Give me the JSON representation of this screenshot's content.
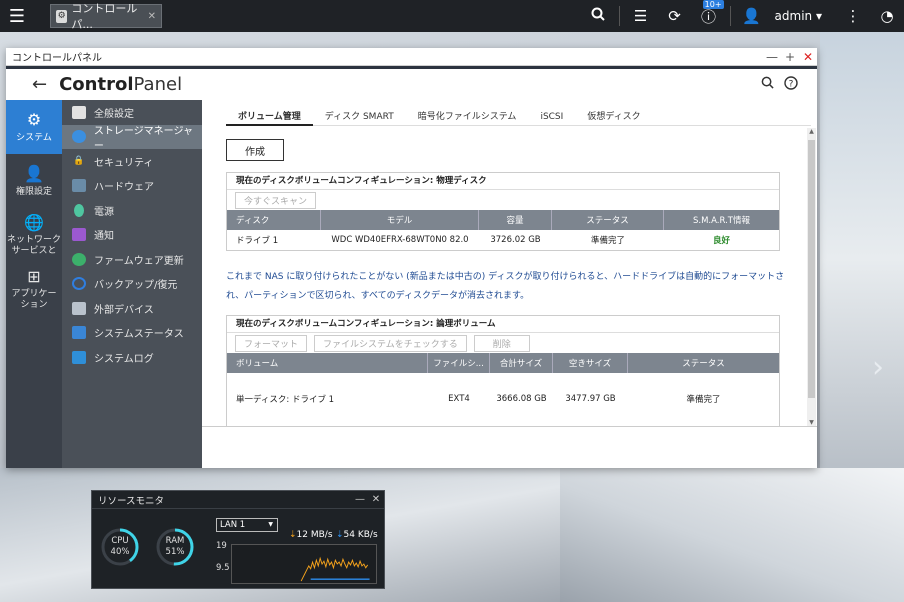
{
  "taskbar": {
    "tab_label": "コントロールパ...",
    "notifications_badge": "10+",
    "user": "admin"
  },
  "window": {
    "title": "コントロールパネル",
    "app_title_bold": "Control",
    "app_title_light": "Panel"
  },
  "rail": [
    {
      "label": "システム",
      "icon": "gear-icon"
    },
    {
      "label": "権限設定",
      "icon": "user-icon"
    },
    {
      "label": "ネットワーク\nサービスと",
      "icon": "globe-icon"
    },
    {
      "label": "アプリケー\nション",
      "icon": "apps-icon"
    }
  ],
  "subnav": [
    {
      "label": "全般設定",
      "icon": "general-settings-icon",
      "color": "#e2e2e2"
    },
    {
      "label": "ストレージマネージャー",
      "icon": "storage-icon",
      "color": "#3b8fe0"
    },
    {
      "label": "セキュリティ",
      "icon": "lock-icon",
      "color": "#d8d8d8"
    },
    {
      "label": "ハードウェア",
      "icon": "hardware-icon",
      "color": "#6a8ca8"
    },
    {
      "label": "電源",
      "icon": "power-icon",
      "color": "#4fc6a0"
    },
    {
      "label": "通知",
      "icon": "notification-icon",
      "color": "#9b59d0"
    },
    {
      "label": "ファームウェア更新",
      "icon": "firmware-icon",
      "color": "#3cb06b"
    },
    {
      "label": "バックアップ/復元",
      "icon": "backup-icon",
      "color": "#2f7ee0"
    },
    {
      "label": "外部デバイス",
      "icon": "external-device-icon",
      "color": "#b9c2cc"
    },
    {
      "label": "システムステータス",
      "icon": "system-status-icon",
      "color": "#3a86d6"
    },
    {
      "label": "システムログ",
      "icon": "system-log-icon",
      "color": "#2f8fd8"
    }
  ],
  "tabs": [
    "ボリューム管理",
    "ディスク SMART",
    "暗号化ファイルシステム",
    "iSCSI",
    "仮想ディスク"
  ],
  "create_button": "作成",
  "physical": {
    "title": "現在のディスクボリュームコンフィギュレーション: 物理ディスク",
    "scan_button": "今すぐスキャン",
    "headers": [
      "ディスク",
      "モデル",
      "容量",
      "ステータス",
      "S.M.A.R.T情報"
    ],
    "row": [
      "ドライブ 1",
      "WDC WD40EFRX-68WT0N0 82.0",
      "3726.02 GB",
      "準備完了",
      "良好"
    ]
  },
  "notice": "これまで NAS に取り付けられたことがない (新品または中古の) ディスクが取り付けられると、ハードドライブは自動的にフォーマットされ、パーティションで区切られ、すべてのディスクデータが消去されます。",
  "logical": {
    "title": "現在のディスクボリュームコンフィギュレーション: 論理ボリューム",
    "buttons": [
      "フォーマット",
      "ファイルシステムをチェックする",
      "削除"
    ],
    "headers": [
      "ボリューム",
      "ファイルシ...",
      "合計サイズ",
      "空きサイズ",
      "ステータス"
    ],
    "row": [
      "単一ディスク: ドライブ 1",
      "EXT4",
      "3666.08 GB",
      "3477.97 GB",
      "準備完了"
    ]
  },
  "resmon": {
    "title": "リソースモニタ",
    "cpu_label": "CPU",
    "cpu_value": "40%",
    "cpu_pct": 40,
    "ram_label": "RAM",
    "ram_value": "51%",
    "ram_pct": 51,
    "lan": "LAN 1",
    "upload": "12 MB/s",
    "download": "54 KB/s",
    "y_top": "19",
    "y_bottom": "9.5"
  }
}
